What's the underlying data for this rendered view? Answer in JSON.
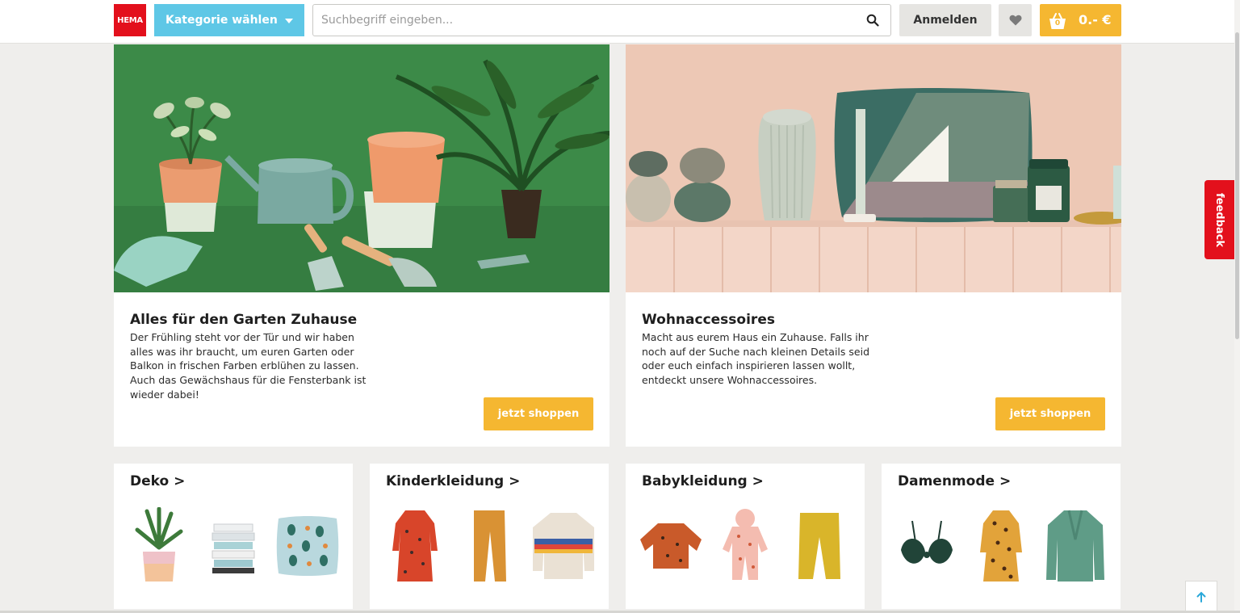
{
  "header": {
    "logo_text": "HEMA",
    "category_button": "Kategorie wählen",
    "search_placeholder": "Suchbegriff eingeben...",
    "login_label": "Anmelden",
    "cart_count": "0",
    "cart_total": "0.- €"
  },
  "promos": [
    {
      "title": "Alles für den Garten Zuhause",
      "text": "Der Frühling steht vor der Tür und wir haben alles was ihr braucht, um euren Garten oder Balkon in frischen Farben erblühen zu lassen. Auch das Gewächshaus für die Fensterbank ist wieder dabei!",
      "button": "jetzt shoppen"
    },
    {
      "title": "Wohnaccessoires",
      "text": "Macht aus eurem Haus ein Zuhause. Falls ihr noch auf der Suche nach kleinen Details seid oder euch einfach inspirieren lassen wollt, entdeckt unsere Wohnaccessoires.",
      "button": "jetzt shoppen"
    }
  ],
  "categories": [
    {
      "label": "Deko >"
    },
    {
      "label": "Kinderkleidung >"
    },
    {
      "label": "Babykleidung >"
    },
    {
      "label": "Damenmode >"
    }
  ],
  "feedback_label": "feedback",
  "colors": {
    "brand_red": "#e3101c",
    "accent_blue": "#5ec7e6",
    "accent_yellow": "#f5b731",
    "background": "#efeeec"
  }
}
